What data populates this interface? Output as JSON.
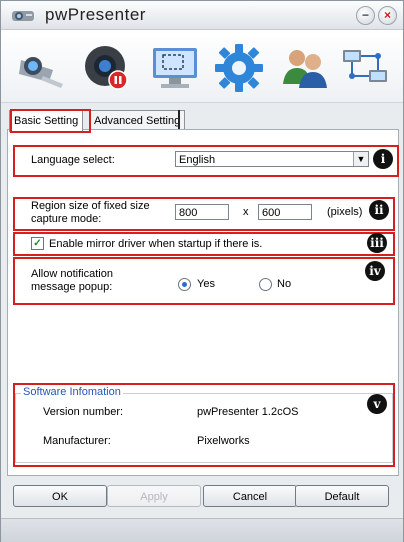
{
  "window": {
    "title": "pwPresenter",
    "minimize_glyph": "−",
    "close_glyph": "×"
  },
  "toolbar": {
    "items": [
      {
        "icon": "projector-icon"
      },
      {
        "icon": "webcam-record-icon"
      },
      {
        "icon": "screen-capture-icon"
      },
      {
        "icon": "settings-gear-icon"
      },
      {
        "icon": "users-icon"
      },
      {
        "icon": "network-icon"
      }
    ]
  },
  "tabs": [
    {
      "label": "Basic Setting",
      "active": true
    },
    {
      "label": "Advanced Setting",
      "active": false
    }
  ],
  "settings": {
    "language": {
      "label": "Language select:",
      "value": "English",
      "badge": "i"
    },
    "region": {
      "label": "Region size of fixed size capture mode:",
      "width": "800",
      "separator": "x",
      "height": "600",
      "unit": "(pixels)",
      "badge": "ii"
    },
    "mirror": {
      "label": "Enable mirror driver when startup if there is.",
      "checked": true,
      "badge": "iii"
    },
    "notification": {
      "label": "Allow notification message popup:",
      "yes_label": "Yes",
      "no_label": "No",
      "selected": "Yes",
      "badge": "iv"
    }
  },
  "software_info": {
    "legend": "Software Infomation",
    "version_label": "Version number:",
    "version_value": "pwPresenter 1.2cOS",
    "manufacturer_label": "Manufacturer:",
    "manufacturer_value": "Pixelworks",
    "badge": "v"
  },
  "buttons": {
    "ok": "OK",
    "apply": "Apply",
    "cancel": "Cancel",
    "default": "Default"
  },
  "colors": {
    "annotation_red": "#d62020",
    "legend_blue": "#2357b6"
  }
}
